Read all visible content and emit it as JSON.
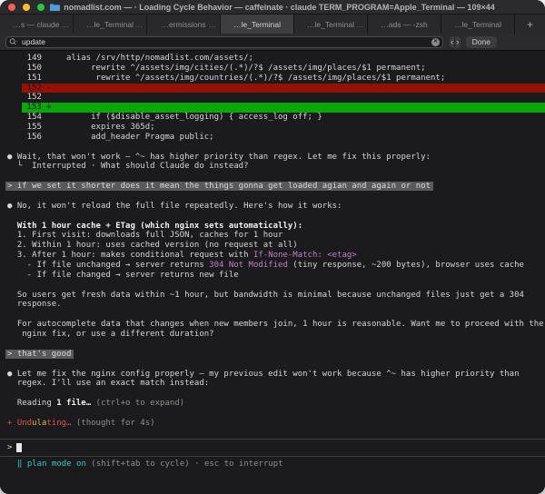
{
  "window": {
    "title": "nomadlist.com — · Loading Cycle Behavior — caffeinate · claude TERM_PROGRAM=Apple_Terminal — 109×44"
  },
  "tabs": [
    {
      "label": "…s — claude",
      "more": "…",
      "active": false
    },
    {
      "label": "…le_Terminal",
      "more": "…",
      "active": false
    },
    {
      "label": "…ermissions",
      "more": "…",
      "active": false
    },
    {
      "label": "…le_Terminal",
      "more": "",
      "active": true
    },
    {
      "label": "…le_Terminal",
      "more": "…",
      "active": false
    },
    {
      "label": "…ads — -zsh",
      "more": "",
      "active": false
    },
    {
      "label": "…le_Terminal",
      "more": "",
      "active": false
    }
  ],
  "new_tab_label": "+",
  "find_bar": {
    "query": "update",
    "clear_glyph": "✕",
    "prev_glyph": "‹",
    "next_glyph": "›",
    "done_label": "Done"
  },
  "colors": {
    "diff_removed_bg": "#931206",
    "diff_added_bg": "#0ba60b",
    "user_message_bg": "#59595b",
    "code_purple": "#c07fc9",
    "status_teal": "#35c9c0",
    "thinking_red": "#de534d",
    "thinking_yellow": "#d9b84a"
  },
  "terminal": {
    "prompt_char": ">",
    "lines": [
      {
        "type": "t",
        "seg": [
          {
            "t": "    149     alias /srv/http/nomadlist.com/assets/;",
            "s": ""
          }
        ]
      },
      {
        "type": "t",
        "seg": [
          {
            "t": "    150          rewrite ^/assets/img/cities/(.*)/?$ /assets/img/places/$1 permanent;",
            "s": ""
          }
        ]
      },
      {
        "type": "t",
        "seg": [
          {
            "t": "    151           rewrite ^/assets/img/countries/(.*)/?$ /assets/img/places/$1 permanent;",
            "s": ""
          }
        ]
      },
      {
        "type": "red",
        "seg": [
          {
            "t": " 152 -",
            "s": ""
          }
        ]
      },
      {
        "type": "t",
        "seg": [
          {
            "t": "    152",
            "s": ""
          }
        ]
      },
      {
        "type": "green",
        "seg": [
          {
            "t": " 153 +",
            "s": ""
          }
        ]
      },
      {
        "type": "t",
        "seg": [
          {
            "t": "    154          if ($disable_asset_logging) { access_log off; }",
            "s": ""
          }
        ]
      },
      {
        "type": "t",
        "seg": [
          {
            "t": "    155          expires 365d;",
            "s": ""
          }
        ]
      },
      {
        "type": "t",
        "seg": [
          {
            "t": "    156          add_header Pragma public;",
            "s": ""
          }
        ]
      },
      {
        "type": "gap"
      },
      {
        "type": "t",
        "seg": [
          {
            "t": "● Wait, that won't work — ^~ has higher priority than regex. Let me fix this properly:",
            "s": ""
          }
        ]
      },
      {
        "type": "t",
        "seg": [
          {
            "t": "  └  Interrupted · What should Claude do instead?",
            "s": ""
          }
        ]
      },
      {
        "type": "gap"
      },
      {
        "type": "hl",
        "seg": [
          {
            "t": "> if we set it shorter does it mean the things gonna get loaded agian and again or not",
            "s": "hl"
          }
        ]
      },
      {
        "type": "gap"
      },
      {
        "type": "t",
        "seg": [
          {
            "t": "● No, it won't reload the full file repeatedly. Here's how it works:",
            "s": ""
          }
        ]
      },
      {
        "type": "gap"
      },
      {
        "type": "t",
        "seg": [
          {
            "t": "  ",
            "s": ""
          },
          {
            "t": "With 1 hour cache + ETag (which nginx sets automatically):",
            "s": "b"
          }
        ]
      },
      {
        "type": "t",
        "seg": [
          {
            "t": "  1. First visit: downloads full JSON, caches for 1 hour",
            "s": ""
          }
        ]
      },
      {
        "type": "t",
        "seg": [
          {
            "t": "  2. Within 1 hour: uses cached version (no request at all)",
            "s": ""
          }
        ]
      },
      {
        "type": "t",
        "seg": [
          {
            "t": "  3. After 1 hour: makes conditional request with ",
            "s": ""
          },
          {
            "t": "If-None-Match: <etag>",
            "s": "purple"
          }
        ]
      },
      {
        "type": "t",
        "seg": [
          {
            "t": "    - If file unchanged → server returns ",
            "s": ""
          },
          {
            "t": "304 Not Modified",
            "s": "purple"
          },
          {
            "t": " (tiny response, ~200 bytes), browser uses cache",
            "s": ""
          }
        ]
      },
      {
        "type": "t",
        "seg": [
          {
            "t": "    - If file changed → server returns new file",
            "s": ""
          }
        ]
      },
      {
        "type": "gap"
      },
      {
        "type": "t",
        "seg": [
          {
            "t": "  So users get fresh data within ~1 hour, but bandwidth is minimal because unchanged files just get a 304",
            "s": ""
          }
        ]
      },
      {
        "type": "t",
        "seg": [
          {
            "t": "  response.",
            "s": ""
          }
        ]
      },
      {
        "type": "gap"
      },
      {
        "type": "t",
        "seg": [
          {
            "t": "  For autocomplete data that changes when new members join, 1 hour is reasonable. Want me to proceed with the",
            "s": ""
          }
        ]
      },
      {
        "type": "t",
        "seg": [
          {
            "t": "   nginx fix, or use a different duration?",
            "s": ""
          }
        ]
      },
      {
        "type": "gap"
      },
      {
        "type": "hl",
        "seg": [
          {
            "t": "> that's good",
            "s": "hl"
          }
        ]
      },
      {
        "type": "gap"
      },
      {
        "type": "t",
        "seg": [
          {
            "t": "● Let me fix the nginx config properly — my previous edit won't work because ^~ has higher priority than",
            "s": ""
          }
        ]
      },
      {
        "type": "t",
        "seg": [
          {
            "t": "  regex. I'll use an exact match instead:",
            "s": ""
          }
        ]
      },
      {
        "type": "gap"
      },
      {
        "type": "t",
        "seg": [
          {
            "t": "  Reading ",
            "s": ""
          },
          {
            "t": "1 file…",
            "s": "b"
          },
          {
            "t": " (ctrl+o to expand)",
            "s": "dim"
          }
        ]
      },
      {
        "type": "gap"
      },
      {
        "type": "t",
        "seg": [
          {
            "t": "+ Und",
            "s": "red"
          },
          {
            "t": "ula",
            "s": "yellow"
          },
          {
            "t": "ting…",
            "s": "red"
          },
          {
            "t": " (thought for 4s)",
            "s": "dim"
          }
        ]
      },
      {
        "type": "gap"
      }
    ],
    "status_segments": [
      {
        "t": "‖ ",
        "s": "teal",
        "name": "pause-icon"
      },
      {
        "t": "plan mode on",
        "s": "teal",
        "name": "plan-mode-label"
      },
      {
        "t": " (shift+tab to cycle) · esc to interrupt",
        "s": "dim",
        "name": "status-hints"
      }
    ]
  }
}
